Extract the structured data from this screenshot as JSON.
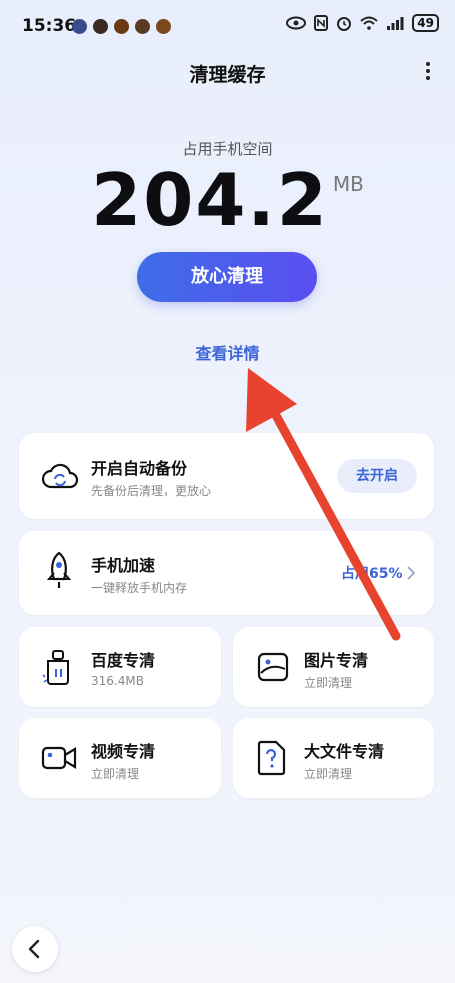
{
  "status_bar": {
    "time": "15:36",
    "battery": "49"
  },
  "header": {
    "title": "清理缓存"
  },
  "storage": {
    "label": "占用手机空间",
    "value": "204.2",
    "unit": "MB"
  },
  "actions": {
    "clean_button": "放心清理",
    "details_link": "查看详情"
  },
  "cards": {
    "backup": {
      "title": "开启自动备份",
      "subtitle": "先备份后清理，更放心",
      "button": "去开启"
    },
    "boost": {
      "title": "手机加速",
      "subtitle": "一键释放手机内存",
      "usage": "占用65%"
    },
    "baidu": {
      "title": "百度专清",
      "subtitle": "316.4MB"
    },
    "photos": {
      "title": "图片专清",
      "subtitle": "立即清理"
    },
    "videos": {
      "title": "视频专清",
      "subtitle": "立即清理"
    },
    "large_files": {
      "title": "大文件专清",
      "subtitle": "立即清理"
    }
  },
  "colors": {
    "accent": "#3d63d8",
    "button_gradient_start": "#3e6de8",
    "button_gradient_end": "#5b4ef0",
    "annotation_arrow": "#e8432f"
  }
}
